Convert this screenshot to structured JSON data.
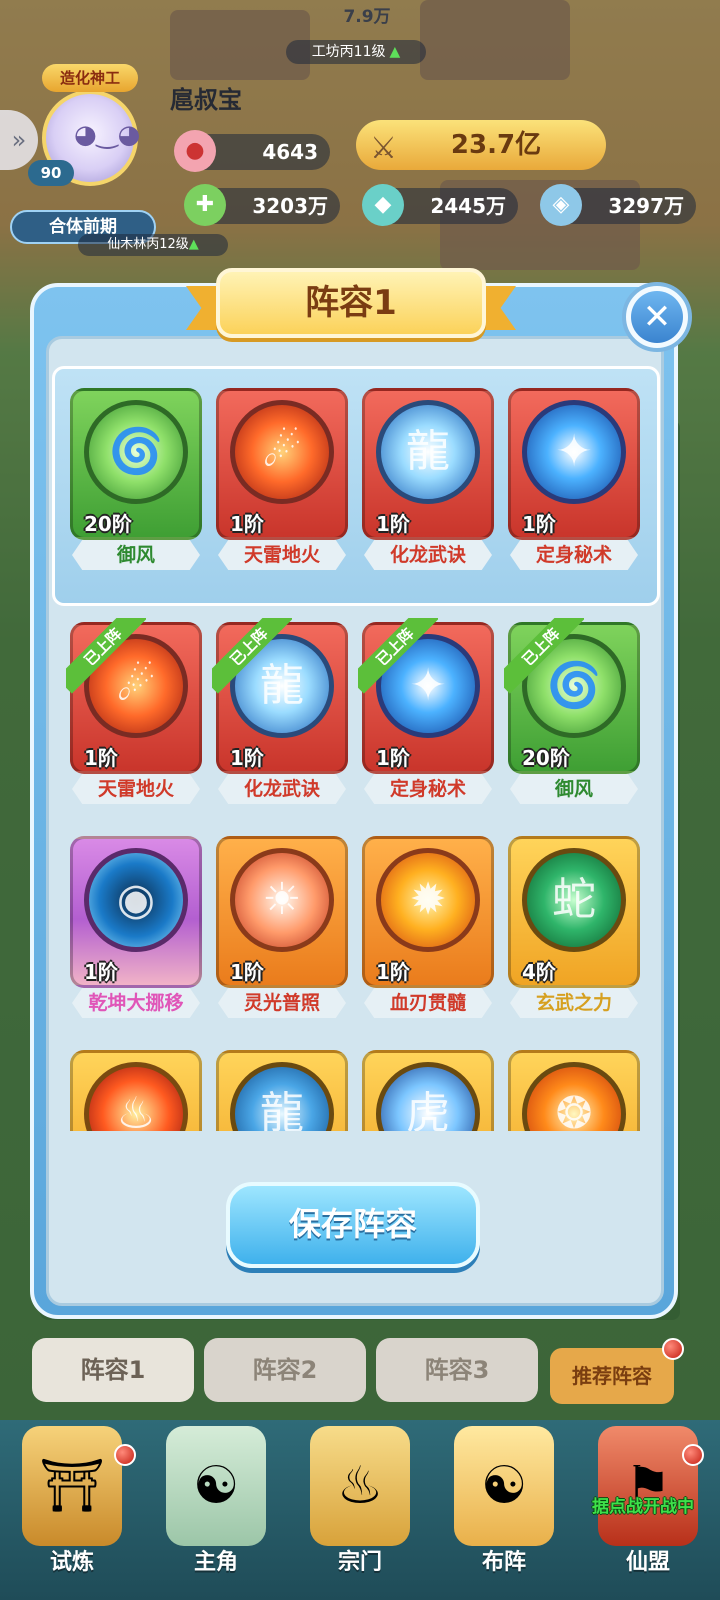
{
  "background": {
    "top_value": "7.9万",
    "top_building_level": "工坊丙11级",
    "mid_building_level": "仙木林丙12级"
  },
  "player": {
    "avatar_title": "造化神工",
    "level": "90",
    "merge_button": "合体前期",
    "name": "扈叔宝",
    "power": "23.7亿",
    "resources": [
      {
        "icon": "peach-icon",
        "value": "4643"
      },
      {
        "icon": "herb-icon",
        "value": "3203万"
      },
      {
        "icon": "crystal-icon",
        "value": "2445万"
      },
      {
        "icon": "stone-icon",
        "value": "3297万"
      }
    ]
  },
  "modal": {
    "title": "阵容1",
    "save_button": "保存阵容",
    "equipped": [
      {
        "name": "御风",
        "rank": "20阶",
        "color": "green",
        "orb": "wind",
        "icon": "whirlwind-icon",
        "name_color": "green"
      },
      {
        "name": "天雷地火",
        "rank": "1阶",
        "color": "red",
        "orb": "fire",
        "icon": "meteor-fire-icon",
        "name_color": "red"
      },
      {
        "name": "化龙武诀",
        "rank": "1阶",
        "color": "red",
        "orb": "ice",
        "icon": "ice-dragon-icon",
        "name_color": "red"
      },
      {
        "name": "定身秘术",
        "rank": "1阶",
        "color": "red",
        "orb": "blue",
        "icon": "binding-spark-icon",
        "name_color": "red"
      }
    ],
    "skill_list": [
      {
        "name": "天雷地火",
        "rank": "1阶",
        "color": "red",
        "orb": "fire",
        "icon": "meteor-fire-icon",
        "name_color": "red",
        "tag": "已上阵"
      },
      {
        "name": "化龙武诀",
        "rank": "1阶",
        "color": "red",
        "orb": "ice",
        "icon": "ice-dragon-icon",
        "name_color": "red",
        "tag": "已上阵"
      },
      {
        "name": "定身秘术",
        "rank": "1阶",
        "color": "red",
        "orb": "blue",
        "icon": "binding-spark-icon",
        "name_color": "red",
        "tag": "已上阵"
      },
      {
        "name": "御风",
        "rank": "20阶",
        "color": "green",
        "orb": "wind",
        "icon": "whirlwind-icon",
        "name_color": "green",
        "tag": "已上阵"
      },
      {
        "name": "乾坤大挪移",
        "rank": "1阶",
        "color": "purple",
        "orb": "void",
        "icon": "void-swap-icon",
        "name_color": "pink",
        "tag": ""
      },
      {
        "name": "灵光普照",
        "rank": "1阶",
        "color": "orange",
        "orb": "light",
        "icon": "radiance-icon",
        "name_color": "red",
        "tag": ""
      },
      {
        "name": "血刃贯髓",
        "rank": "1阶",
        "color": "orange",
        "orb": "blaze",
        "icon": "blood-blade-icon",
        "name_color": "red",
        "tag": ""
      },
      {
        "name": "玄武之力",
        "rank": "4阶",
        "color": "gold",
        "orb": "jade",
        "icon": "tortoise-serpent-icon",
        "name_color": "gold",
        "tag": ""
      },
      {
        "name": "",
        "rank": "",
        "color": "gold",
        "orb": "phoenix",
        "icon": "phoenix-icon",
        "name_color": "red",
        "tag": ""
      },
      {
        "name": "",
        "rank": "",
        "color": "gold",
        "orb": "dragon",
        "icon": "azure-dragon-icon",
        "name_color": "red",
        "tag": ""
      },
      {
        "name": "",
        "rank": "",
        "color": "gold",
        "orb": "tiger",
        "icon": "white-tiger-icon",
        "name_color": "red",
        "tag": ""
      },
      {
        "name": "",
        "rank": "",
        "color": "gold",
        "orb": "flame",
        "icon": "flame-wave-icon",
        "name_color": "red",
        "tag": ""
      }
    ]
  },
  "lineup_tabs": [
    "阵容1",
    "阵容2",
    "阵容3"
  ],
  "recommend_button": "推荐阵容",
  "bottom_nav": [
    {
      "label": "试炼",
      "icon": "shrine-icon"
    },
    {
      "label": "主角",
      "icon": "meditating-figure-icon"
    },
    {
      "label": "宗门",
      "icon": "incense-burner-icon"
    },
    {
      "label": "布阵",
      "icon": "yin-yang-icon"
    },
    {
      "label": "仙盟",
      "icon": "alliance-banner-icon"
    }
  ],
  "nav_banner": "据点战开战中",
  "colors": {
    "modal_blue": "#5aa6db",
    "panel_bg": "#d2e5ef",
    "title_gold": "#fbd25a",
    "save_blue": "#3fb1ec",
    "green_name": "#2e8a30",
    "red_name": "#d03a2a",
    "pink_name": "#e055b8",
    "gold_name": "#d6a020"
  }
}
